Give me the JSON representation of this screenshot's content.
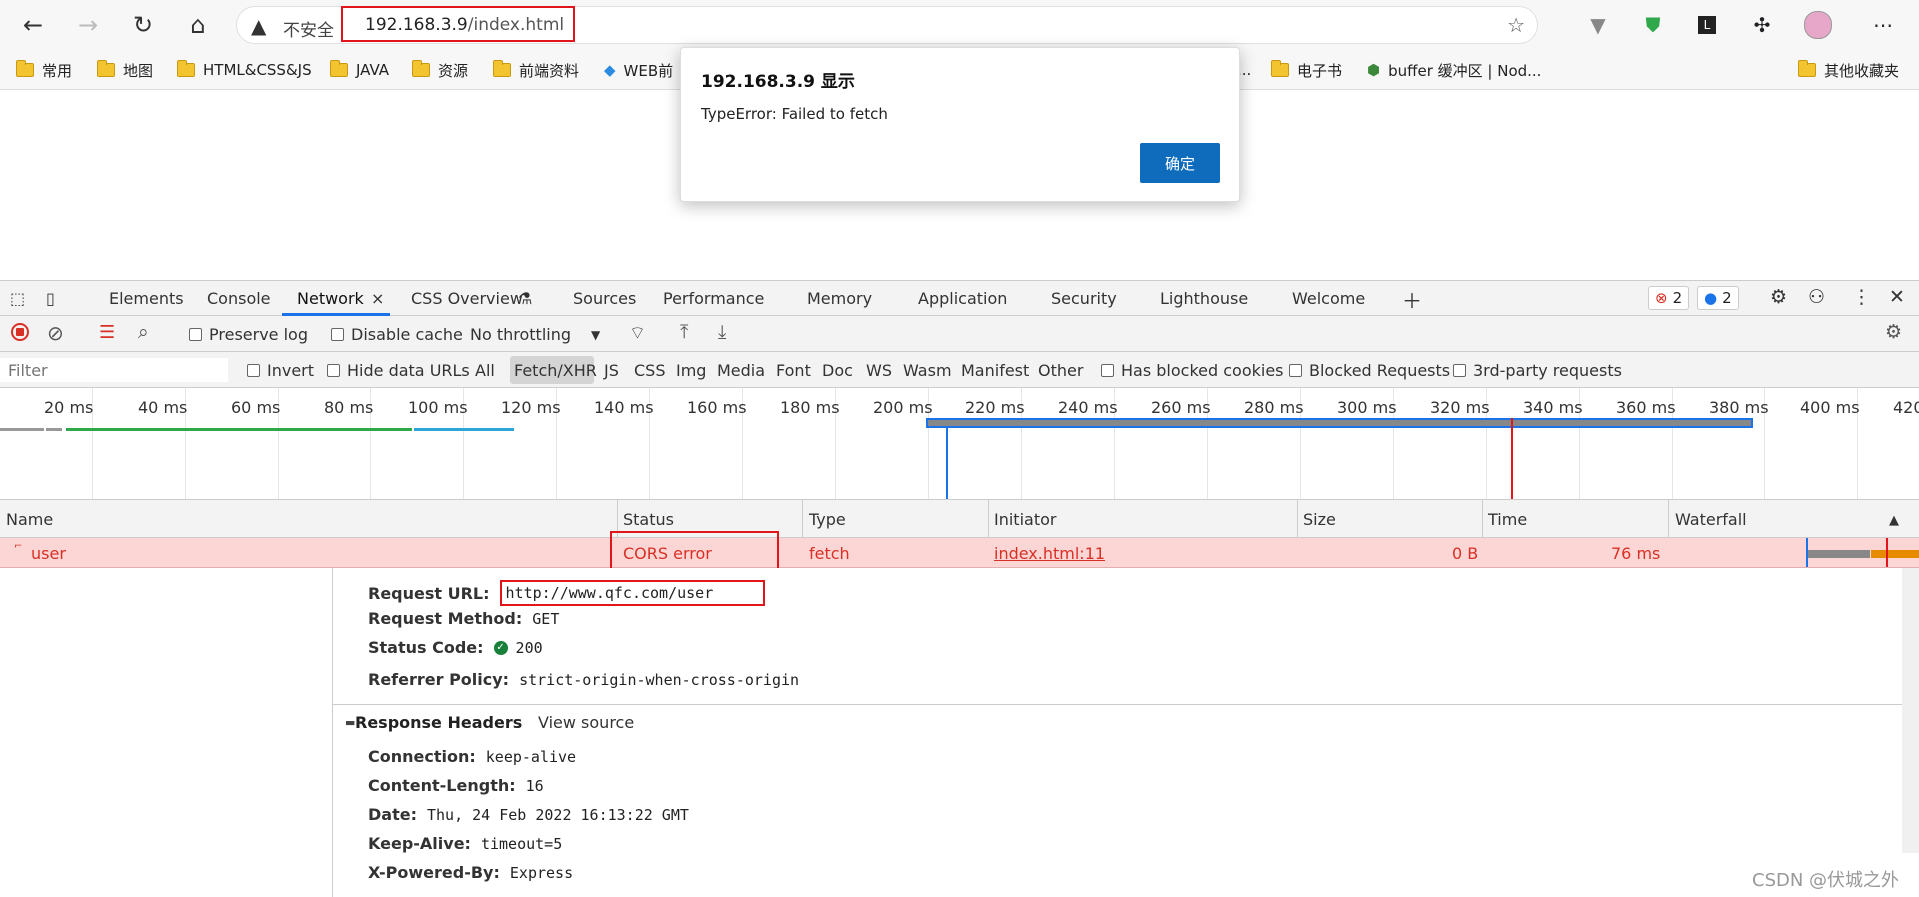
{
  "toolbar": {
    "insecure_label": "不安全",
    "url_host": "192.168.3.9",
    "url_path": "/index.html"
  },
  "bookmarks": [
    {
      "label": "常用"
    },
    {
      "label": "地图"
    },
    {
      "label": "HTML&CSS&JS"
    },
    {
      "label": "JAVA"
    },
    {
      "label": "资源"
    },
    {
      "label": "前端资料"
    },
    {
      "label": "WEB前"
    },
    {
      "label": "..."
    },
    {
      "label": "电子书"
    },
    {
      "label": "buffer 缓冲区 | Nod..."
    },
    {
      "label": "其他收藏夹"
    }
  ],
  "dialog": {
    "title": "192.168.3.9 显示",
    "message": "TypeError: Failed to fetch",
    "ok_label": "确定"
  },
  "devtools": {
    "tabs": [
      "Elements",
      "Console",
      "Network",
      "CSS Overview",
      "Sources",
      "Performance",
      "Memory",
      "Application",
      "Security",
      "Lighthouse",
      "Welcome"
    ],
    "close_glyph": "×",
    "error_count": "2",
    "message_count": "2"
  },
  "network_toolbar": {
    "preserve_log": "Preserve log",
    "disable_cache": "Disable cache",
    "throttling": "No throttling"
  },
  "filter_bar": {
    "placeholder": "Filter",
    "invert": "Invert",
    "hide_data_urls": "Hide data URLs",
    "types": [
      "All",
      "Fetch/XHR",
      "JS",
      "CSS",
      "Img",
      "Media",
      "Font",
      "Doc",
      "WS",
      "Wasm",
      "Manifest",
      "Other"
    ],
    "has_blocked_cookies": "Has blocked cookies",
    "blocked_requests": "Blocked Requests",
    "third_party": "3rd-party requests"
  },
  "timeline": {
    "ticks": [
      "20 ms",
      "40 ms",
      "60 ms",
      "80 ms",
      "100 ms",
      "120 ms",
      "140 ms",
      "160 ms",
      "180 ms",
      "200 ms",
      "220 ms",
      "240 ms",
      "260 ms",
      "280 ms",
      "300 ms",
      "320 ms",
      "340 ms",
      "360 ms",
      "380 ms",
      "400 ms",
      "420"
    ]
  },
  "table": {
    "columns": [
      "Name",
      "Status",
      "Type",
      "Initiator",
      "Size",
      "Time",
      "Waterfall"
    ],
    "row": {
      "name": "user",
      "status": "CORS error",
      "type": "fetch",
      "initiator": "index.html:11",
      "size": "0 B",
      "time": "76 ms"
    }
  },
  "general": {
    "request_url_label": "Request URL:",
    "request_url": "http://www.qfc.com/user",
    "request_method_label": "Request Method:",
    "request_method": "GET",
    "status_code_label": "Status Code:",
    "status_code": "200",
    "referrer_policy_label": "Referrer Policy:",
    "referrer_policy": "strict-origin-when-cross-origin"
  },
  "response_headers": {
    "title": "Response Headers",
    "view_source": "View source",
    "items": [
      {
        "key": "Connection:",
        "value": "keep-alive"
      },
      {
        "key": "Content-Length:",
        "value": "16"
      },
      {
        "key": "Date:",
        "value": "Thu, 24 Feb 2022 16:13:22 GMT"
      },
      {
        "key": "Keep-Alive:",
        "value": "timeout=5"
      },
      {
        "key": "X-Powered-By:",
        "value": "Express"
      }
    ]
  },
  "watermark": "CSDN @伏城之外"
}
